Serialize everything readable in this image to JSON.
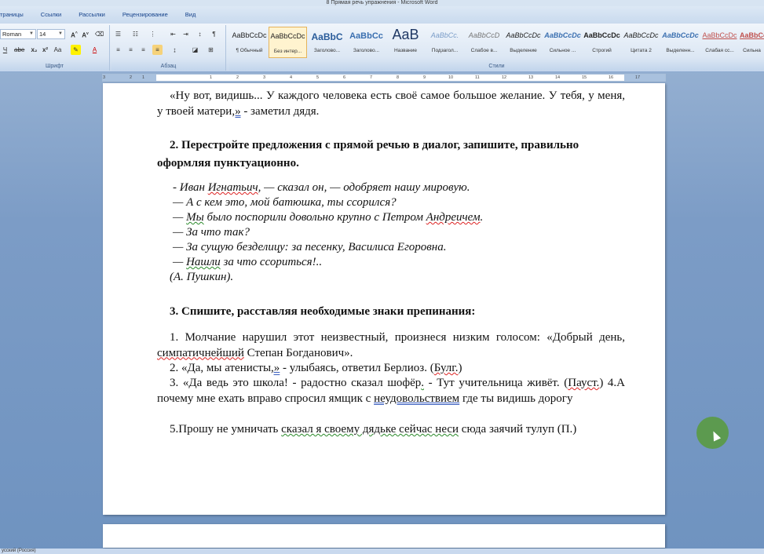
{
  "window": {
    "title": "8 Прямая речь упражнения - Microsoft Word"
  },
  "tabs": [
    "траницы",
    "Ссылки",
    "Рассылки",
    "Рецензирование",
    "Вид"
  ],
  "ribbon": {
    "font": {
      "name": "Roman",
      "size": "14",
      "label": "Шрифт"
    },
    "paragraph": {
      "label": "Абзац"
    },
    "styles": {
      "label": "Стили",
      "items": [
        {
          "preview": "AaBbCcDc",
          "name": "¶ Обычный"
        },
        {
          "preview": "AaBbCcDc",
          "name": "Без интер..."
        },
        {
          "preview": "AaBbC",
          "name": "Заголово..."
        },
        {
          "preview": "AaBbCc",
          "name": "Заголово..."
        },
        {
          "preview": "AaB",
          "name": "Название"
        },
        {
          "preview": "AaBbCc.",
          "name": "Подзагол..."
        },
        {
          "preview": "AaBbCcD",
          "name": "Слабое в..."
        },
        {
          "preview": "AaBbCcDc",
          "name": "Выделение"
        },
        {
          "preview": "AaBbCcDc",
          "name": "Сильное ..."
        },
        {
          "preview": "AaBbCcDc",
          "name": "Строгий"
        },
        {
          "preview": "AaBbCcDc",
          "name": "Цитата 2"
        },
        {
          "preview": "AaBbCcDc",
          "name": "Выделенн..."
        },
        {
          "preview": "AaBbCcDc",
          "name": "Слабая сс..."
        },
        {
          "preview": "AaBbCc",
          "name": "Сильна"
        }
      ]
    }
  },
  "ruler": {
    "ticks": [
      "3",
      "2",
      "1",
      "1",
      "2",
      "3",
      "4",
      "5",
      "6",
      "7",
      "8",
      "9",
      "10",
      "11",
      "12",
      "13",
      "14",
      "15",
      "16",
      "17"
    ]
  },
  "document": {
    "p1": {
      "a": "«Ну вот, видишь... У каждого человека есть своё самое большое желание. У тебя, у меня, у твоей матери",
      "b": ",»",
      "c": " - заметил дядя."
    },
    "task2": {
      "num": "2.",
      "text": " Перестройте предложения с прямой речью в диалог, запишите, правильно оформляя пунктуационно."
    },
    "dialog": [
      {
        "pre": "- Иван ",
        "err": "Игнатьич",
        "post": ", — сказал он, — одобряет нашу мировую."
      },
      {
        "pre": "— А с кем это, мой батюшка, ты ссорился?",
        "err": "",
        "post": ""
      },
      {
        "pre": "— ",
        "err": "Мы",
        "post": " было поспорили довольно крупно с Петром ",
        "err2": "Андреичем",
        "post2": "."
      },
      {
        "pre": "— За что так?",
        "err": "",
        "post": ""
      },
      {
        "pre": "— За сущую безделицу: за песенку, Василиса Егоровна.",
        "err": "",
        "post": ""
      },
      {
        "pre": "— ",
        "err": "Нашли",
        "post": " за что ссориться!.."
      },
      {
        "pre": "(А. Пушкин).",
        "err": "",
        "post": ""
      }
    ],
    "task3": {
      "num": "3.",
      "text": "  Спишите, расставляя необходимые знаки препинания:"
    },
    "ex1": {
      "a": "1. Молчание нарушил этот неизвестный, произнеся низким голосом: «Добрый день, ",
      "b": "симпатичнейший",
      "c": " Степан Богданович»."
    },
    "ex2": {
      "a": "2. «Да, мы атенисты",
      "b": ",»",
      "c": " -  улыбаясь,  ответил Берлиоз. (",
      "d": "Булг.",
      "e": ")"
    },
    "ex3": {
      "a": "3. «Да ведь это школа! -   радостно сказал шофёр",
      "b": ".",
      "c": " - Тут учительница живёт. (",
      "d": "Пауст.",
      "e": ") 4.А почему мне ехать вправо спросил ямщик  с ",
      "f": "неудовольствием",
      "g": " где ты видишь дорогу"
    },
    "ex5": {
      "a": "5.Прошу не умничать ",
      "b": "сказал я своему дядьке сейчас неси",
      "c": " сюда заячий тулуп (П.)"
    }
  },
  "statusbar": {
    "language": "усский (Россия)"
  }
}
